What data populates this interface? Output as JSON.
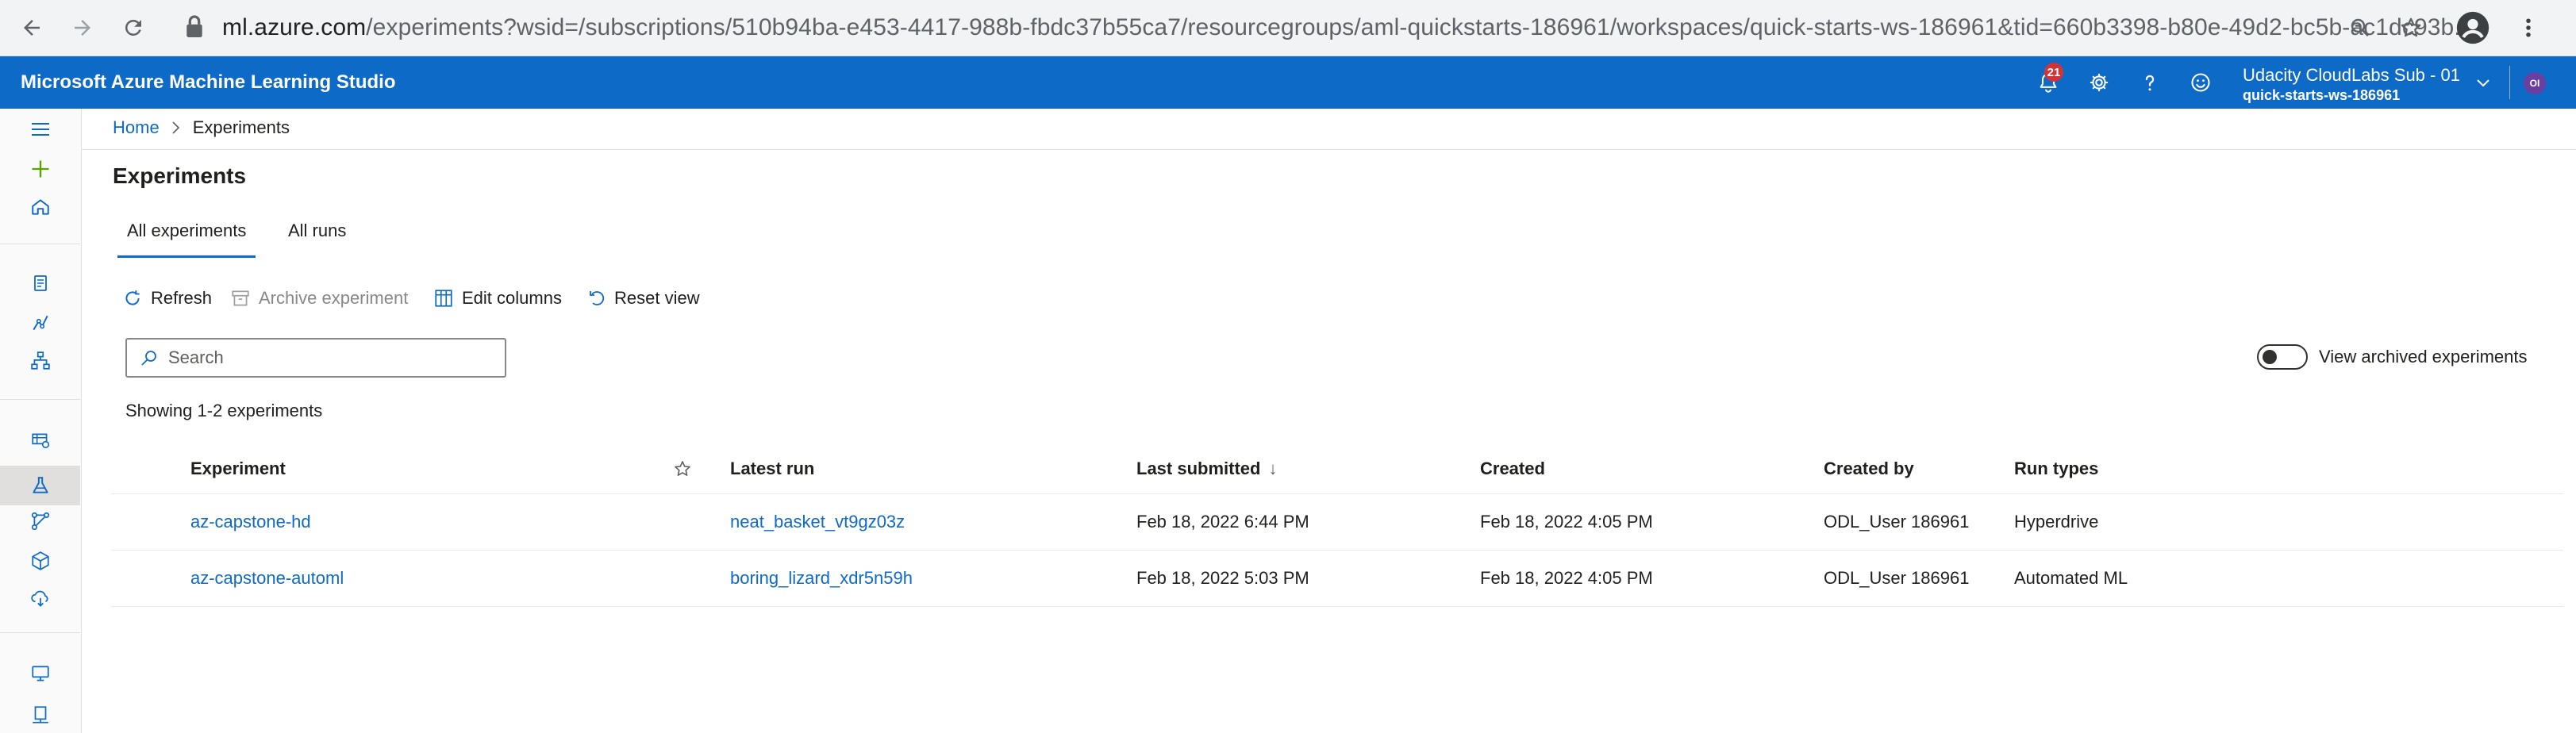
{
  "browser": {
    "url_domain": "ml.azure.com",
    "url_rest": "/experiments?wsid=/subscriptions/510b94ba-e453-4417-988b-fbdc37b55ca7/resourcegroups/aml-quickstarts-186961/workspaces/quick-starts-ws-186961&tid=660b3398-b80e-49d2-bc5b-ac1dc93b..."
  },
  "header": {
    "title": "Microsoft Azure Machine Learning Studio",
    "notification_count": "21",
    "subscription": "Udacity CloudLabs Sub - 01",
    "workspace": "quick-starts-ws-186961",
    "avatar_initials": "OI"
  },
  "breadcrumb": {
    "home": "Home",
    "current": "Experiments"
  },
  "page": {
    "title": "Experiments",
    "tabs": [
      {
        "label": "All experiments",
        "active": true
      },
      {
        "label": "All runs",
        "active": false
      }
    ]
  },
  "toolbar": {
    "refresh": "Refresh",
    "archive": "Archive experiment",
    "edit_columns": "Edit columns",
    "reset_view": "Reset view"
  },
  "search": {
    "placeholder": "Search",
    "value": ""
  },
  "archived_toggle": {
    "label": "View archived experiments",
    "on": false
  },
  "showing_text": "Showing 1-2 experiments",
  "table": {
    "columns": {
      "experiment": "Experiment",
      "latest_run": "Latest run",
      "last_submitted": "Last submitted",
      "created": "Created",
      "created_by": "Created by",
      "run_types": "Run types"
    },
    "sort_indicator": "↓",
    "rows": [
      {
        "experiment": "az-capstone-hd",
        "latest_run": "neat_basket_vt9gz03z",
        "last_submitted": "Feb 18, 2022 6:44 PM",
        "created": "Feb 18, 2022 4:05 PM",
        "created_by": "ODL_User 186961",
        "run_types": "Hyperdrive"
      },
      {
        "experiment": "az-capstone-automl",
        "latest_run": "boring_lizard_xdr5n59h",
        "last_submitted": "Feb 18, 2022 5:03 PM",
        "created": "Feb 18, 2022 4:05 PM",
        "created_by": "ODL_User 186961",
        "run_types": "Automated ML"
      }
    ]
  },
  "colors": {
    "header_bg": "#0e6ac7",
    "link": "#0e6ac7",
    "badge": "#d13438"
  },
  "icons": {
    "browser": [
      "back-arrow-icon",
      "forward-arrow-icon",
      "reload-icon",
      "lock-icon",
      "zoom-icon",
      "star-icon",
      "profile-icon",
      "kebab-menu-icon"
    ],
    "header": [
      "bell-icon",
      "gear-icon",
      "help-icon",
      "smiley-icon",
      "chevron-down-icon"
    ],
    "rail": [
      "hamburger-icon",
      "plus-icon",
      "home-icon",
      "notebook-icon",
      "automl-icon",
      "designer-icon",
      "datasets-icon",
      "experiments-icon",
      "pipelines-icon",
      "models-icon",
      "endpoints-icon",
      "compute-icon",
      "datastores-icon"
    ]
  }
}
